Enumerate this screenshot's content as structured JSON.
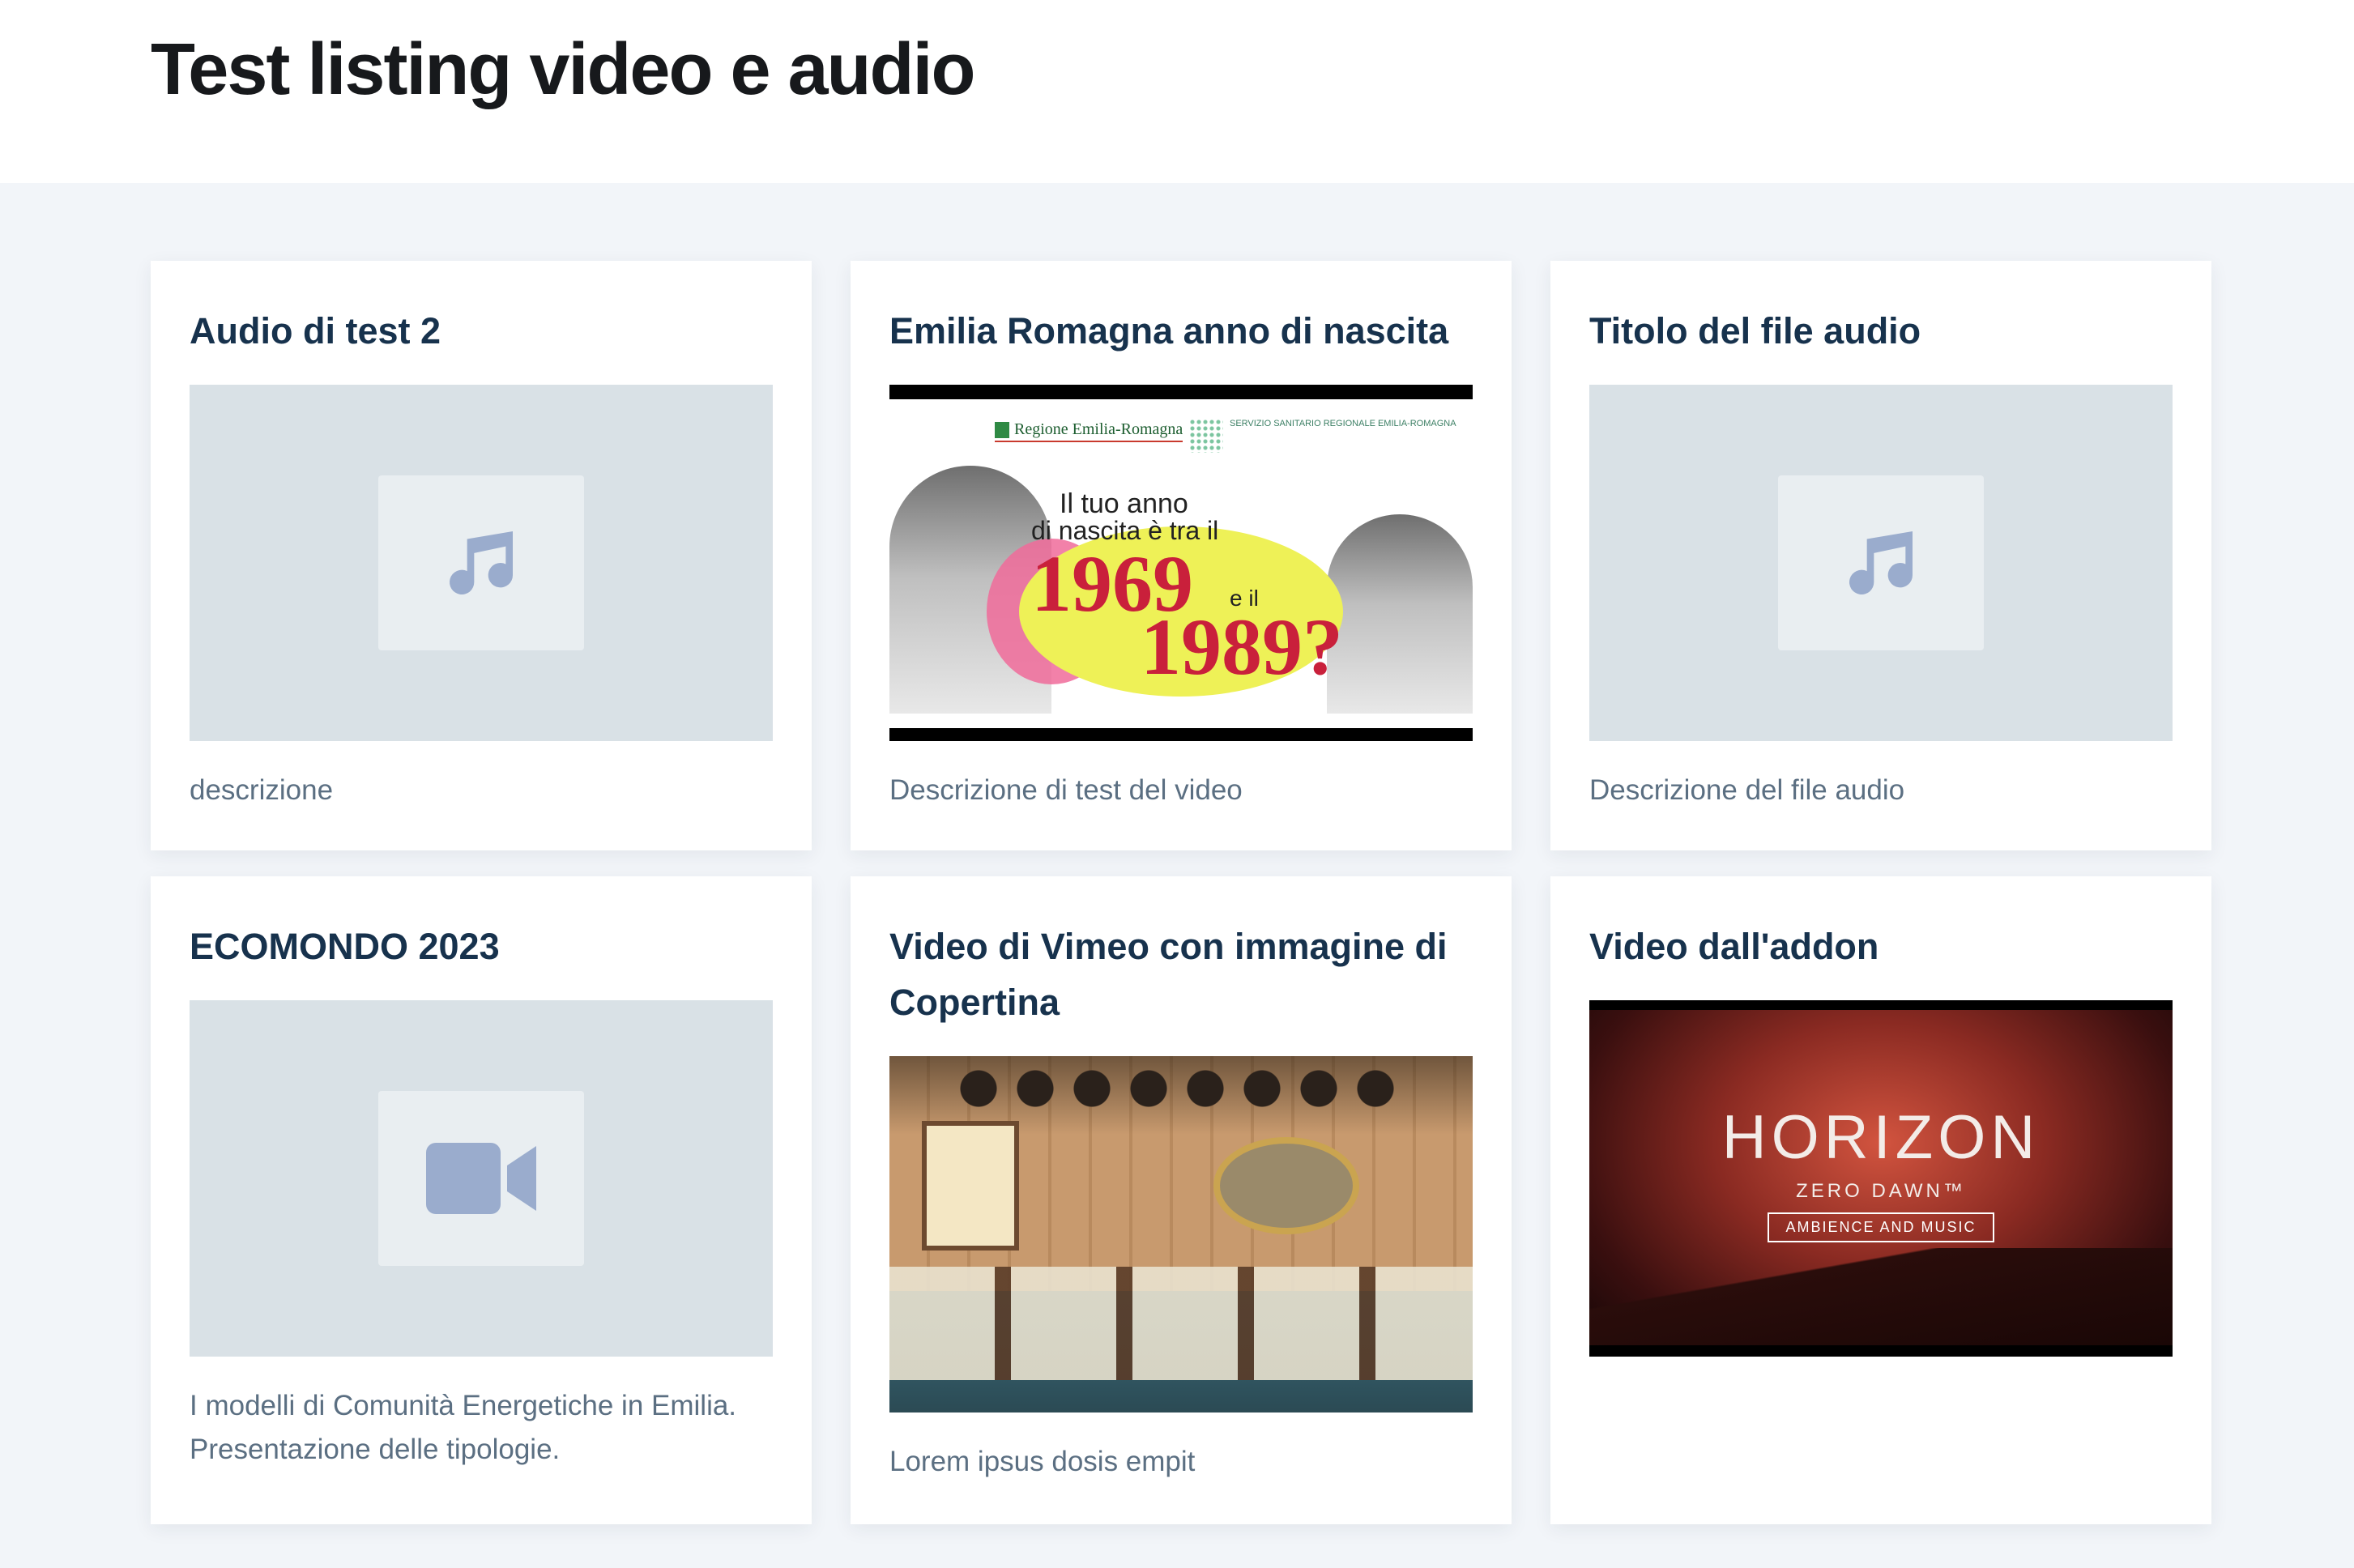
{
  "page": {
    "title": "Test listing video e audio"
  },
  "cards": [
    {
      "title": "Audio di test 2",
      "media": "audio-placeholder",
      "icon": "music-note-icon",
      "description": "descrizione"
    },
    {
      "title": "Emilia Romagna anno di nascita",
      "media": "video-thumbnail",
      "thumbnail_text": {
        "logo_region": "Regione Emilia-Romagna",
        "logo_service": "SERVIZIO SANITARIO REGIONALE EMILIA-ROMAGNA",
        "line1": "Il tuo anno",
        "line2": "di nascita è tra il",
        "year1": "1969",
        "conj": "e il",
        "year2": "1989?"
      },
      "description": "Descrizione di test del video"
    },
    {
      "title": "Titolo del file audio",
      "media": "audio-placeholder",
      "icon": "music-note-icon",
      "description": "Descrizione del file audio"
    },
    {
      "title": "ECOMONDO 2023",
      "media": "video-placeholder",
      "icon": "video-camera-icon",
      "description": "I modelli di Comunità Energetiche in Emilia. Presentazione delle tipologie."
    },
    {
      "title": "Video di Vimeo con immagine di Copertina",
      "media": "restaurant-image",
      "description": "Lorem ipsus dosis empit"
    },
    {
      "title": "Video dall'addon",
      "media": "horizon-thumbnail",
      "thumbnail_text": {
        "title": "HORIZON",
        "subtitle": "ZERO DAWN™",
        "tagline": "AMBIENCE AND MUSIC"
      },
      "description": ""
    }
  ],
  "colors": {
    "title": "#17191c",
    "card_title": "#17324d",
    "description": "#5b6f82",
    "listing_bg": "#f2f5f9",
    "placeholder_bg": "#d9e1e6",
    "placeholder_icon": "#9aaccd"
  }
}
